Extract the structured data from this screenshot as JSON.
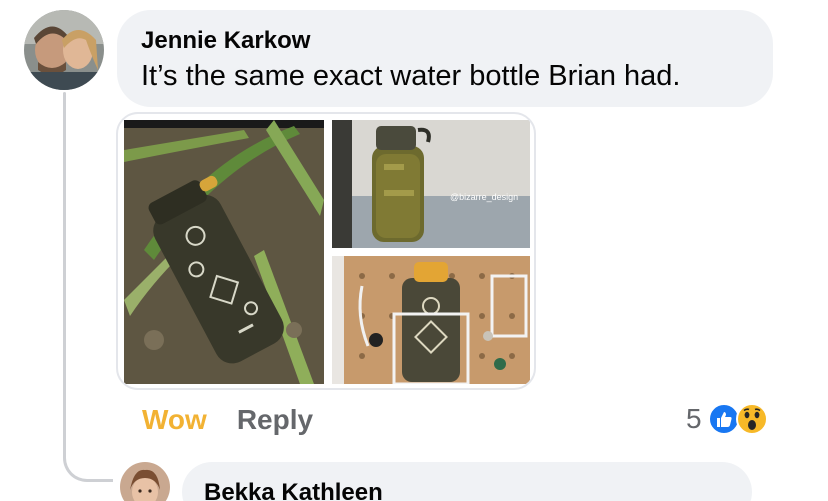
{
  "comment": {
    "author": "Jennie Karkow",
    "text": "It’s the same exact water bottle Brian had.",
    "photos": [
      {
        "alt": "bottle-in-grass",
        "watermark": ""
      },
      {
        "alt": "bottle-on-table",
        "watermark": "@bizarre_design"
      },
      {
        "alt": "bottle-on-pegboard",
        "watermark": ""
      }
    ],
    "actions": {
      "wow_label": "Wow",
      "reply_label": "Reply"
    },
    "reactions": {
      "count": "5",
      "icons": [
        "like-icon",
        "wow-icon"
      ],
      "colors": {
        "like": "#1877f2",
        "wow": "#f7b928"
      }
    }
  },
  "reply": {
    "author": "Bekka Kathleen"
  },
  "colors": {
    "bubble": "#f0f2f5",
    "text": "#050505",
    "muted": "#65676b",
    "wow_active": "#f2b233",
    "thread_line": "#ced0d4"
  }
}
